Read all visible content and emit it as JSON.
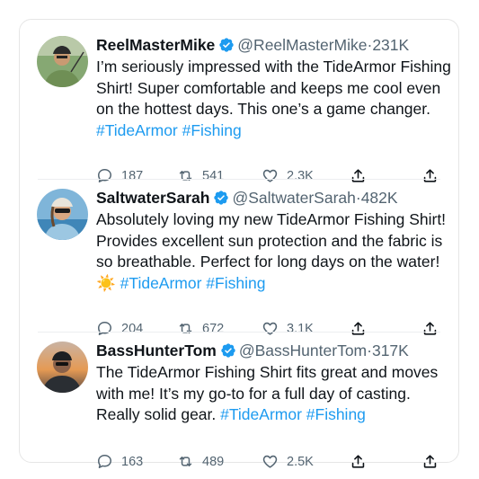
{
  "tweets": [
    {
      "name": "ReelMasterMike",
      "handle": "@ReelMasterMike",
      "followers": "231K",
      "text": "I’m seriously impressed with the TideArmor Fishing Shirt! Super comfortable and keeps me cool even on the hottest days. This one’s a game changer. ",
      "hashtags": "#TideArmor #Fishing",
      "emoji": "",
      "replies": "187",
      "retweets": "541",
      "likes": "2.3K"
    },
    {
      "name": "SaltwaterSarah",
      "handle": "@SaltwaterSarah",
      "followers": "482K",
      "text": "Absolutely loving my new TideArmor Fishing Shirt! Provides excellent sun protection and the fabric is so breathable. Perfect for long days on the water! ",
      "hashtags": "#TideArmor #Fishing",
      "emoji": "☀️",
      "replies": "204",
      "retweets": "672",
      "likes": "3.1K"
    },
    {
      "name": "BassHunterTom",
      "handle": "@BassHunterTom",
      "followers": "317K",
      "text": "The TideArmor Fishing Shirt fits great and moves with me! It’s my go-to for a full day of casting. Really solid gear. ",
      "hashtags": "#TideArmor #Fishing",
      "emoji": "",
      "replies": "163",
      "retweets": "489",
      "likes": "2.5K"
    }
  ],
  "dot": "·",
  "icons": [
    "reply-icon",
    "retweet-icon",
    "like-icon",
    "share-icon",
    "share-icon"
  ],
  "colors": {
    "verified": "#1d9bf0",
    "hashtag": "#1d9bf0",
    "muted": "#536471"
  }
}
